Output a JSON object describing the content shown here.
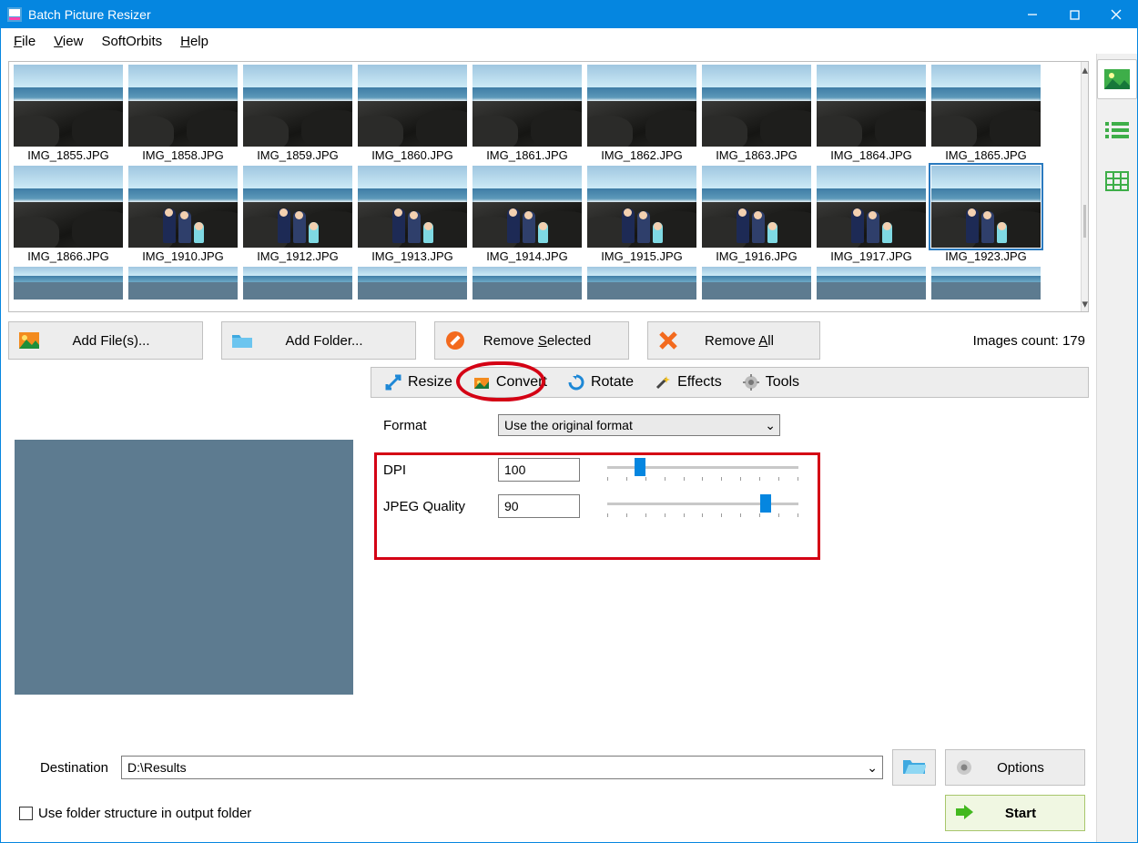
{
  "titlebar": {
    "title": "Batch Picture Resizer"
  },
  "menu": {
    "file": "File",
    "view": "View",
    "softorbits": "SoftOrbits",
    "help": "Help"
  },
  "thumbnails": [
    "IMG_1855.JPG",
    "IMG_1858.JPG",
    "IMG_1859.JPG",
    "IMG_1860.JPG",
    "IMG_1861.JPG",
    "IMG_1862.JPG",
    "IMG_1863.JPG",
    "IMG_1864.JPG",
    "IMG_1865.JPG",
    "IMG_1866.JPG",
    "IMG_1910.JPG",
    "IMG_1912.JPG",
    "IMG_1913.JPG",
    "IMG_1914.JPG",
    "IMG_1915.JPG",
    "IMG_1916.JPG",
    "IMG_1917.JPG",
    "IMG_1923.JPG"
  ],
  "selected_thumbnail_index": 17,
  "actions": {
    "add_files": "Add File(s)...",
    "add_folder": "Add Folder...",
    "remove_selected": "Remove Selected",
    "remove_all": "Remove All"
  },
  "images_count_label": "Images count: 179",
  "tabs": {
    "resize": "Resize",
    "convert": "Convert",
    "rotate": "Rotate",
    "effects": "Effects",
    "tools": "Tools",
    "active": "convert"
  },
  "convert": {
    "format_label": "Format",
    "format_value": "Use the original format",
    "dpi_label": "DPI",
    "dpi_value": "100",
    "dpi_slider_percent": 15,
    "jpeg_label": "JPEG Quality",
    "jpeg_value": "90",
    "jpeg_slider_percent": 85
  },
  "destination": {
    "label": "Destination",
    "value": "D:\\Results"
  },
  "use_folder_structure_label": "Use folder structure in output folder",
  "buttons": {
    "options": "Options",
    "start": "Start"
  }
}
